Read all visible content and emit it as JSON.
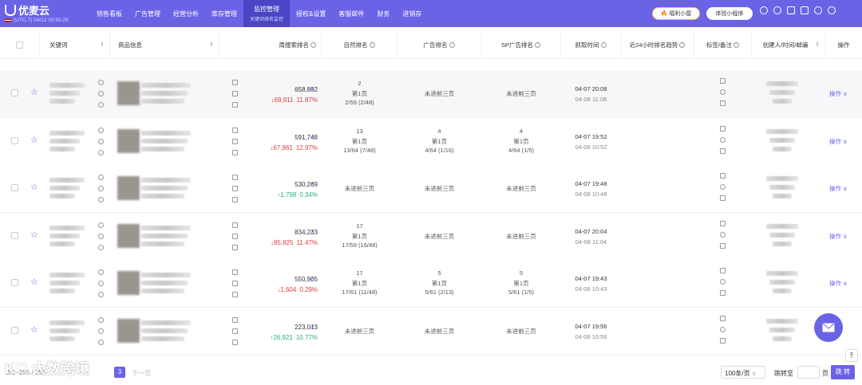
{
  "app": {
    "name": "优麦云",
    "timezone": "(UTC-7) 04/12 05:50:29"
  },
  "nav": [
    {
      "label": "销售看板"
    },
    {
      "label": "广告管理"
    },
    {
      "label": "经营分析"
    },
    {
      "label": "库存管理"
    },
    {
      "label": "监控管理",
      "sub": "关键词排名监控"
    },
    {
      "label": "授权&设置"
    },
    {
      "label": "客服邮件"
    },
    {
      "label": "财务"
    },
    {
      "label": "进销存"
    }
  ],
  "header_buttons": {
    "welfare": "🔥 福利小屋",
    "miniapp": "体验小程序"
  },
  "columns": {
    "keyword": "关键词",
    "product": "商品信息",
    "weekly": "周搜索排名",
    "natural": "自然排名",
    "ad": "广告排名",
    "sp": "SP广告排名",
    "time": "抓取时间",
    "trend": "近24小时排名趋势",
    "tag": "标签/备注",
    "creator": "创建人/时间/邮编",
    "action": "操作"
  },
  "rows": [
    {
      "weekly": "658,892",
      "delta": "↓69,911",
      "pct": "11.87%",
      "dir": "down",
      "nat": [
        "2",
        "第1页",
        "2/59 (2/48)"
      ],
      "ad": [
        "",
        "未进前三页",
        ""
      ],
      "sp": [
        "",
        "未进前三页",
        ""
      ],
      "t1": "04-07 20:08",
      "t2": "04-08 11:08",
      "op": "操作 ∨"
    },
    {
      "weekly": "591,748",
      "delta": "↓67,961",
      "pct": "12.97%",
      "dir": "down",
      "nat": [
        "13",
        "第1页",
        "13/64 (7/48)"
      ],
      "ad": [
        "4",
        "第1页",
        "4/64 (1/16)"
      ],
      "sp": [
        "4",
        "第1页",
        "4/64 (1/5)"
      ],
      "t1": "04-07 19:52",
      "t2": "04-08 10:52",
      "op": "操作 ∨"
    },
    {
      "weekly": "530,269",
      "delta": "↑1,798",
      "pct": "0.34%",
      "dir": "up",
      "nat": [
        "",
        "未进前三页",
        ""
      ],
      "ad": [
        "",
        "未进前三页",
        ""
      ],
      "sp": [
        "",
        "未进前三页",
        ""
      ],
      "t1": "04-07 19:48",
      "t2": "04-08 10:48",
      "op": "操作 ∨"
    },
    {
      "weekly": "834,233",
      "delta": "↓85,825",
      "pct": "11.47%",
      "dir": "down",
      "nat": [
        "17",
        "第1页",
        "17/59 (16/48)"
      ],
      "ad": [
        "",
        "未进前三页",
        ""
      ],
      "sp": [
        "",
        "未进前三页",
        ""
      ],
      "t1": "04-07 20:04",
      "t2": "04-08 11:04",
      "op": "操作 ∨"
    },
    {
      "weekly": "550,905",
      "delta": "↓1,604",
      "pct": "0.29%",
      "dir": "down",
      "nat": [
        "17",
        "第1页",
        "17/61 (11/48)"
      ],
      "ad": [
        "5",
        "第1页",
        "5/61 (2/13)"
      ],
      "sp": [
        "5",
        "第1页",
        "5/61 (1/5)"
      ],
      "t1": "04-07 19:43",
      "t2": "04-08 10:43",
      "op": "操作 ∨"
    },
    {
      "weekly": "223,013",
      "delta": "↑26,921",
      "pct": "10.77%",
      "dir": "up",
      "nat": [
        "",
        "未进前三页",
        ""
      ],
      "ad": [
        "",
        "未进前三页",
        ""
      ],
      "sp": [
        "",
        "未进前三页",
        ""
      ],
      "t1": "04-07 19:56",
      "t2": "04-08 10:56",
      "op": ""
    }
  ],
  "footer": {
    "range": "2/1~255 / 255",
    "page": "3",
    "next": "下一页",
    "page_size": "100条/页",
    "jump_label": "跳转至",
    "page_unit": "页",
    "jump_button": "跳 转"
  },
  "watermark": "大数跨境",
  "colors": {
    "brand": "#6b63e6",
    "down": "#e03b3b",
    "up": "#2ab07a"
  }
}
